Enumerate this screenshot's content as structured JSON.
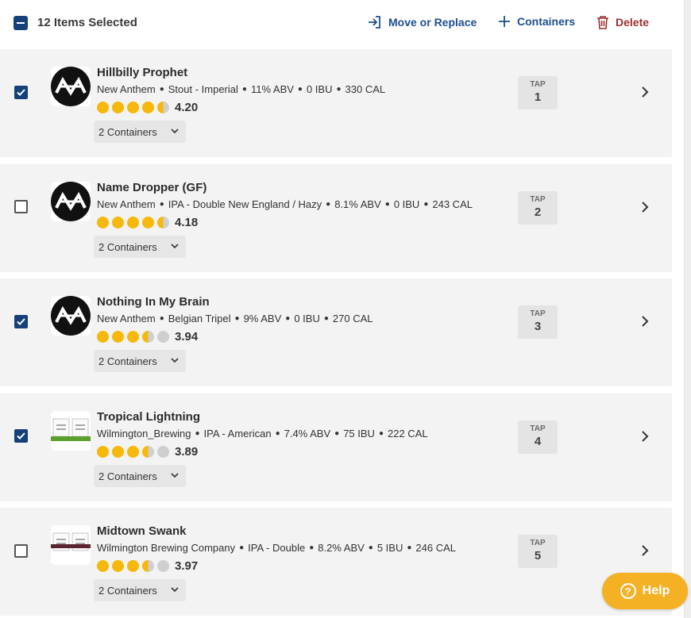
{
  "header": {
    "selected_label": "12 Items Selected",
    "move_label": "Move or Replace",
    "containers_label": "Containers",
    "delete_label": "Delete"
  },
  "items": [
    {
      "name": "Hillbilly Prophet",
      "brewery": "New Anthem",
      "style": "Stout - Imperial",
      "abv": "11% ABV",
      "ibu": "0 IBU",
      "cal": "330 CAL",
      "rating": "4.20",
      "containers": "2 Containers",
      "tap_label": "TAP",
      "tap_number": "1",
      "checked": true,
      "logo": "new-anthem-logo"
    },
    {
      "name": "Name Dropper (GF)",
      "brewery": "New Anthem",
      "style": "IPA - Double New England / Hazy",
      "abv": "8.1% ABV",
      "ibu": "0 IBU",
      "cal": "243 CAL",
      "rating": "4.18",
      "containers": "2 Containers",
      "tap_label": "TAP",
      "tap_number": "2",
      "checked": false,
      "logo": "new-anthem-logo"
    },
    {
      "name": "Nothing In My Brain",
      "brewery": "New Anthem",
      "style": "Belgian Tripel",
      "abv": "9% ABV",
      "ibu": "0 IBU",
      "cal": "270 CAL",
      "rating": "3.94",
      "containers": "2 Containers",
      "tap_label": "TAP",
      "tap_number": "3",
      "checked": true,
      "logo": "new-anthem-logo"
    },
    {
      "name": "Tropical Lightning",
      "brewery": "Wilmington_Brewing",
      "style": "IPA - American",
      "abv": "7.4% ABV",
      "ibu": "75 IBU",
      "cal": "222 CAL",
      "rating": "3.89",
      "containers": "2 Containers",
      "tap_label": "TAP",
      "tap_number": "4",
      "checked": true,
      "logo": "wilmington-label-green"
    },
    {
      "name": "Midtown Swank",
      "brewery": "Wilmington Brewing Company",
      "style": "IPA - Double",
      "abv": "8.2% ABV",
      "ibu": "5 IBU",
      "cal": "246 CAL",
      "rating": "3.97",
      "containers": "2 Containers",
      "tap_label": "TAP",
      "tap_number": "5",
      "checked": false,
      "logo": "wilmington-label-maroon"
    }
  ],
  "help": {
    "label": "Help",
    "icon": "question-icon"
  },
  "colors": {
    "accent": "#15407a",
    "link": "#1d4e8f",
    "delete": "#9a2d2d",
    "star": "#f6b80b",
    "help": "#f4b124",
    "card": "#f3f3f3"
  }
}
